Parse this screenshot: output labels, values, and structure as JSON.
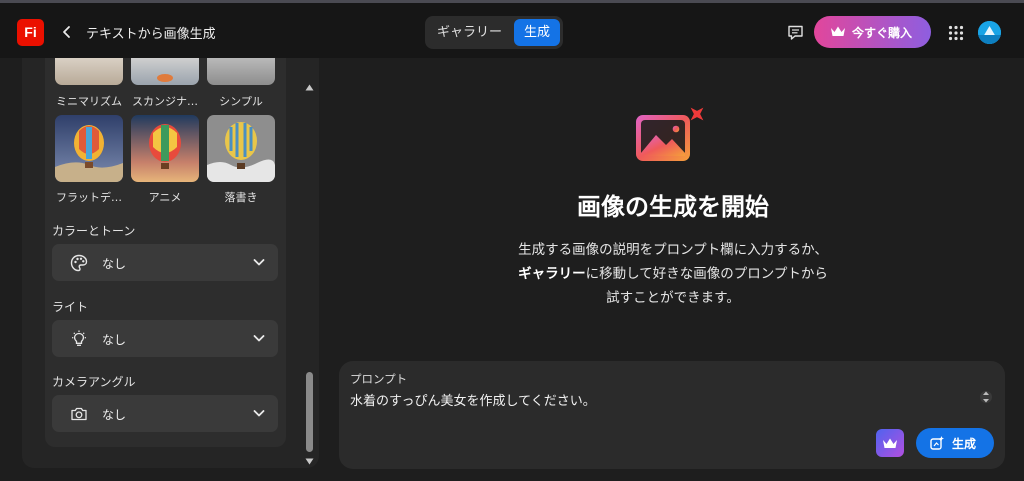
{
  "header": {
    "logo_text": "Fi",
    "page_title": "テキストから画像生成",
    "tabs": [
      {
        "label": "ギャラリー",
        "active": false
      },
      {
        "label": "生成",
        "active": true
      }
    ],
    "buy_label": "今すぐ購入",
    "icons": [
      "chevron-left-icon",
      "feedback-icon",
      "crown-icon",
      "apps-grid-icon",
      "avatar"
    ]
  },
  "styles_panel": {
    "top_row": [
      {
        "label": "ミニマリズム"
      },
      {
        "label": "スカンジナ…"
      },
      {
        "label": "シンプル"
      }
    ],
    "thumbs": [
      {
        "label": "フラットデ…"
      },
      {
        "label": "アニメ"
      },
      {
        "label": "落書き"
      }
    ],
    "sections": [
      {
        "label": "カラーとトーン",
        "value": "なし",
        "icon": "palette-icon"
      },
      {
        "label": "ライト",
        "value": "なし",
        "icon": "lightbulb-icon"
      },
      {
        "label": "カメラアングル",
        "value": "なし",
        "icon": "camera-icon"
      }
    ]
  },
  "main": {
    "heading": "画像の生成を開始",
    "desc_line1": "生成する画像の説明をプロンプト欄に入力するか、",
    "desc_line2_bold": "ギャラリー",
    "desc_line2_rest": "に移動して好きな画像のプロンプトから",
    "desc_line3": "試すことができます。"
  },
  "prompt": {
    "label": "プロンプト",
    "value": "水着のすっぴん美女を作成してください。",
    "generate_label": "生成"
  },
  "colors": {
    "accent": "#1473e6",
    "logo": "#eb1000",
    "buy_gradient_start": "#e2469b",
    "buy_gradient_end": "#8e5ee0"
  }
}
